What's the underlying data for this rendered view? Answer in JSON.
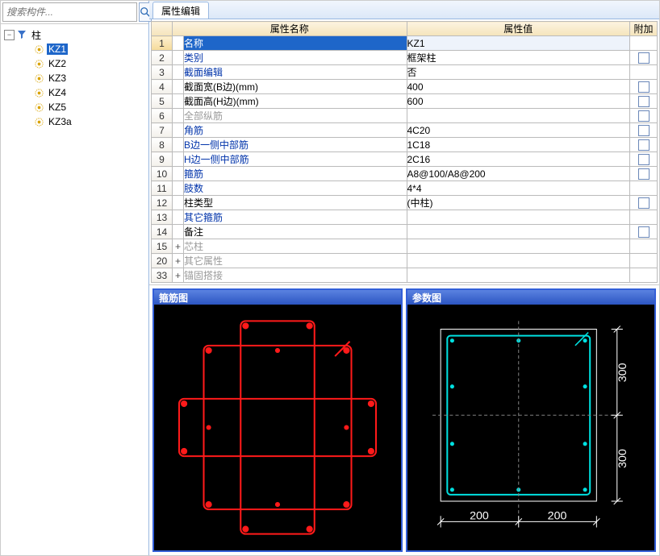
{
  "sidebar": {
    "search_placeholder": "搜索构件...",
    "root": {
      "label": "柱"
    },
    "items": [
      {
        "label": "KZ1",
        "selected": true
      },
      {
        "label": "KZ2"
      },
      {
        "label": "KZ3"
      },
      {
        "label": "KZ4"
      },
      {
        "label": "KZ5"
      },
      {
        "label": "KZ3a"
      }
    ]
  },
  "tabs": {
    "active": "属性编辑"
  },
  "grid": {
    "headers": {
      "name": "属性名称",
      "value": "属性值",
      "extra": "附加"
    },
    "rows": [
      {
        "idx": "1",
        "name": "名称",
        "value": "KZ1",
        "cls": "sel",
        "chk": false,
        "exp": ""
      },
      {
        "idx": "2",
        "name": "类别",
        "value": "框架柱",
        "cls": "blue",
        "chk": true,
        "exp": ""
      },
      {
        "idx": "3",
        "name": "截面编辑",
        "value": "否",
        "cls": "blue",
        "chk": false,
        "exp": ""
      },
      {
        "idx": "4",
        "name": "截面宽(B边)(mm)",
        "value": "400",
        "cls": "",
        "chk": true,
        "exp": ""
      },
      {
        "idx": "5",
        "name": "截面高(H边)(mm)",
        "value": "600",
        "cls": "",
        "chk": true,
        "exp": ""
      },
      {
        "idx": "6",
        "name": "全部纵筋",
        "value": "",
        "cls": "gray",
        "chk": true,
        "exp": ""
      },
      {
        "idx": "7",
        "name": "角筋",
        "value": "4C20",
        "cls": "blue",
        "chk": true,
        "exp": ""
      },
      {
        "idx": "8",
        "name": "B边一侧中部筋",
        "value": "1C18",
        "cls": "blue",
        "chk": true,
        "exp": ""
      },
      {
        "idx": "9",
        "name": "H边一侧中部筋",
        "value": "2C16",
        "cls": "blue",
        "chk": true,
        "exp": ""
      },
      {
        "idx": "10",
        "name": "箍筋",
        "value": "A8@100/A8@200",
        "cls": "blue",
        "chk": true,
        "exp": ""
      },
      {
        "idx": "11",
        "name": "肢数",
        "value": "4*4",
        "cls": "blue",
        "chk": false,
        "exp": ""
      },
      {
        "idx": "12",
        "name": "柱类型",
        "value": "(中柱)",
        "cls": "",
        "chk": true,
        "exp": ""
      },
      {
        "idx": "13",
        "name": "其它箍筋",
        "value": "",
        "cls": "blue",
        "chk": false,
        "exp": ""
      },
      {
        "idx": "14",
        "name": "备注",
        "value": "",
        "cls": "",
        "chk": true,
        "exp": ""
      },
      {
        "idx": "15",
        "name": "芯柱",
        "value": "",
        "cls": "gray",
        "chk": false,
        "exp": "+"
      },
      {
        "idx": "20",
        "name": "其它属性",
        "value": "",
        "cls": "gray",
        "chk": false,
        "exp": "+"
      },
      {
        "idx": "33",
        "name": "锚固搭接",
        "value": "",
        "cls": "gray",
        "chk": false,
        "exp": "+"
      }
    ]
  },
  "diagrams": {
    "left": {
      "title": "箍筋图"
    },
    "right": {
      "title": "参数图",
      "dims": {
        "h1": "200",
        "h2": "200",
        "v1": "300",
        "v2": "300"
      }
    }
  }
}
